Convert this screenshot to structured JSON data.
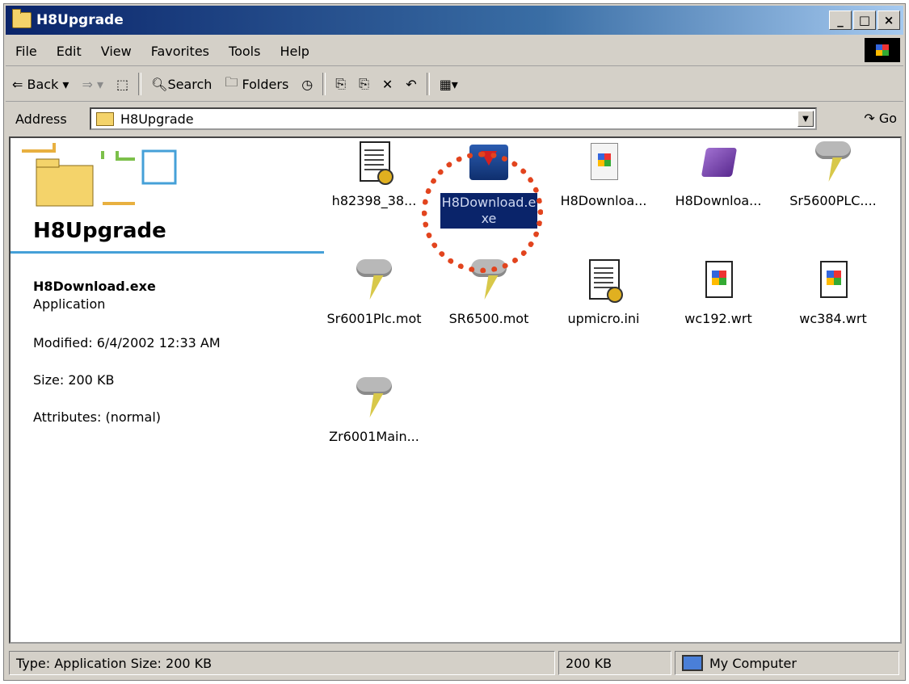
{
  "window": {
    "title": "H8Upgrade",
    "buttons": [
      "_",
      "□",
      "×"
    ]
  },
  "menu": [
    "File",
    "Edit",
    "View",
    "Favorites",
    "Tools",
    "Help"
  ],
  "toolbar": {
    "back": "Back",
    "search": "Search",
    "folders": "Folders"
  },
  "address": {
    "label": "Address",
    "value": "H8Upgrade",
    "go": "Go"
  },
  "left_pane": {
    "folder_title": "H8Upgrade",
    "selected_name": "H8Download.exe",
    "selected_type": "Application",
    "modified": "Modified: 6/4/2002 12:33 AM",
    "size": "Size: 200 KB",
    "attributes": "Attributes: (normal)"
  },
  "files": [
    {
      "name": "h82398_38...",
      "icon": "config-file-icon"
    },
    {
      "name": "H8Download.e",
      "name2": "xe",
      "icon": "download-app-icon",
      "selected": true
    },
    {
      "name": "H8Downloa...",
      "icon": "document-icon"
    },
    {
      "name": "H8Downloa...",
      "icon": "help-book-icon"
    },
    {
      "name": "Sr5600PLC....",
      "icon": "storm-cloud-icon"
    },
    {
      "name": "Sr6001Plc.mot",
      "icon": "storm-cloud-icon"
    },
    {
      "name": "SR6500.mot",
      "icon": "storm-cloud-icon"
    },
    {
      "name": "upmicro.ini",
      "icon": "config-file-icon"
    },
    {
      "name": "wc192.wrt",
      "icon": "write-doc-icon"
    },
    {
      "name": "wc384.wrt",
      "icon": "write-doc-icon"
    },
    {
      "name": "Zr6001Main...",
      "icon": "storm-cloud-icon"
    }
  ],
  "status": {
    "left": "Type: Application Size: 200 KB",
    "size": "200 KB",
    "zone": "My Computer"
  },
  "colors": {
    "title_bar": "#0a246a",
    "selection": "#0a246a",
    "highlight_ring": "#e2441e",
    "accent_line": "#45a0d8"
  }
}
